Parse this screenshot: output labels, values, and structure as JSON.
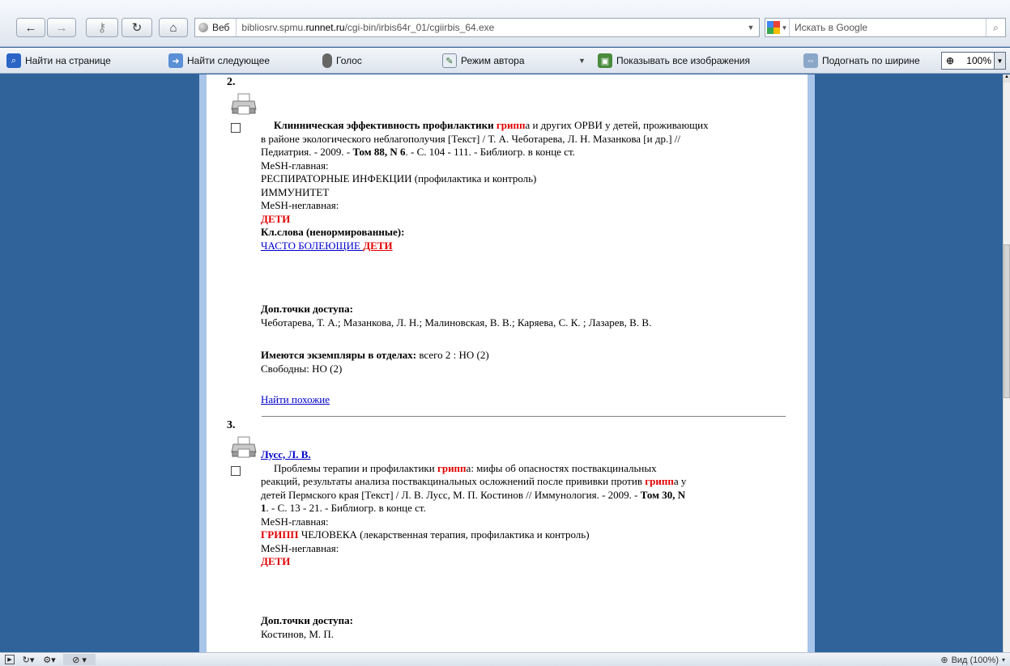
{
  "nav": {
    "address_label": "Веб",
    "url_prefix": "bibliosrv.spmu.",
    "url_domain": "runnet.ru",
    "url_path": "/cgi-bin/irbis64r_01/cgiirbis_64.exe",
    "search_placeholder": "Искать в Google"
  },
  "find_bar": {
    "find_on_page": "Найти на странице",
    "find_next": "Найти следующее",
    "voice": "Голос",
    "author_mode": "Режим автора",
    "show_images": "Показывать все изображения",
    "fit_width": "Подогнать по ширине",
    "zoom": "100%"
  },
  "records": [
    {
      "number": "2.",
      "title_bold_1": "Клинническая эффективность профилактики ",
      "title_hl": "грипп",
      "line1_rest": "а и других ОРВИ у детей, проживающих",
      "line2": "в районе экологического неблагополучия [Текст] / Т. А. Чеботарева, Л. Н. Мазанкова [и др.] //",
      "line3_a": "Педиатрия. - 2009. - ",
      "line3_bold": "Том 88, N 6",
      "line3_b": ". - С. 104 - 111. - Библиогр. в конце ст.",
      "mesh_main_label": "MeSH-главная:",
      "mesh_main_1": "РЕСПИРАТОРНЫЕ ИНФЕКЦИИ (профилактика и контроль)",
      "mesh_main_2": "ИММУНИТЕТ",
      "mesh_sec_label": "MeSH-неглавная:",
      "mesh_sec_1": "ДЕТИ",
      "kw_label": "Кл.слова (ненормированные):",
      "kw_link": "ЧАСТО БОЛЕЮЩИЕ ",
      "kw_hl": "ДЕТИ",
      "access_label": "Доп.точки доступа:",
      "access_names": "Чеботарева, Т. А.; Мазанкова, Л. Н.; Малиновская, В. В.; Каряева, С. К. ; Лазарев, В. В.",
      "copies_label": "Имеются экземпляры в отделах:",
      "copies_value": " всего 2 : НО (2)",
      "free": "Свободны: НО (2)",
      "similar": "Найти похожие"
    },
    {
      "number": "3.",
      "author": "Лусс, Л. В.",
      "l1_a": "Проблемы терапии и профилактики ",
      "l1_hl": "грипп",
      "l1_b": "а: мифы об опасностях поствакцинальных",
      "l2_a": "реакций, результаты анализа поствакцинальных осложнений после прививки против ",
      "l2_hl": "грипп",
      "l2_b": "а у",
      "l3_a": "детей Пермского края [Текст] / Л. В. Лусс, М. П. Костинов // Иммунология. - 2009. - ",
      "l3_bold": "Том 30, N",
      "l4_bold": "1",
      "l4_b": ". - С. 13 - 21. - Библиогр. в конце ст.",
      "mesh_main_label": "MeSH-главная:",
      "mesh_main_hl": "ГРИПП",
      "mesh_main_rest": " ЧЕЛОВЕКА (лекарственная терапия, профилактика и контроль)",
      "mesh_sec_label": "MeSH-неглавная:",
      "mesh_sec_1": "ДЕТИ",
      "access_label": "Доп.точки доступа:",
      "access_names": "Костинов, М. П."
    }
  ],
  "status": {
    "zoom_text": "Вид (100%)"
  },
  "colors": {
    "page_background": "#2f639a",
    "highlight_red": "#e00000",
    "link_blue": "#0000cc"
  }
}
